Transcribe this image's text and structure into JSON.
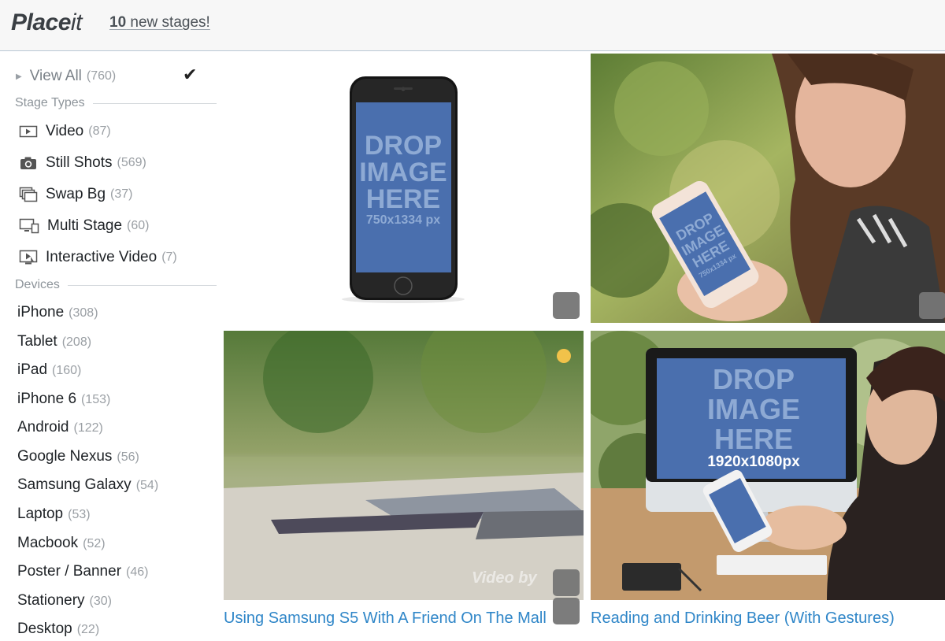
{
  "header": {
    "logo_bold": "Place",
    "logo_light": "it",
    "new_stages_count": "10",
    "new_stages_text": "new stages!"
  },
  "sidebar": {
    "view_all": {
      "label": "View All",
      "count": "(760)",
      "selected": true
    },
    "stage_types_heading": "Stage Types",
    "stage_types": [
      {
        "label": "Video",
        "count": "(87)",
        "icon": "video-icon"
      },
      {
        "label": "Still Shots",
        "count": "(569)",
        "icon": "camera-icon"
      },
      {
        "label": "Swap Bg",
        "count": "(37)",
        "icon": "swap-bg-icon"
      },
      {
        "label": "Multi Stage",
        "count": "(60)",
        "icon": "multi-stage-icon"
      },
      {
        "label": "Interactive Video",
        "count": "(7)",
        "icon": "interactive-video-icon"
      }
    ],
    "devices_heading": "Devices",
    "devices": [
      {
        "label": "iPhone",
        "count": "(308)"
      },
      {
        "label": "Tablet",
        "count": "(208)"
      },
      {
        "label": "iPad",
        "count": "(160)"
      },
      {
        "label": "iPhone 6",
        "count": "(153)"
      },
      {
        "label": "Android",
        "count": "(122)"
      },
      {
        "label": "Google Nexus",
        "count": "(56)"
      },
      {
        "label": "Samsung Galaxy",
        "count": "(54)"
      },
      {
        "label": "Laptop",
        "count": "(53)"
      },
      {
        "label": "Macbook",
        "count": "(52)"
      },
      {
        "label": "Poster / Banner",
        "count": "(46)"
      },
      {
        "label": "Stationery",
        "count": "(30)"
      },
      {
        "label": "Desktop",
        "count": "(22)"
      }
    ]
  },
  "stages": [
    {
      "drop_line1": "DROP",
      "drop_line2": "IMAGE",
      "drop_line3": "HERE",
      "size": "750x1334 px"
    },
    {
      "drop_line1": "DROP",
      "drop_line2": "IMAGE",
      "drop_line3": "HERE",
      "size": "750x1334 px"
    },
    {
      "caption": "Using Samsung S5 With A Friend On The Mall",
      "watermark": "Video by"
    },
    {
      "drop_line1": "DROP",
      "drop_line2": "IMAGE",
      "drop_line3": "HERE",
      "size": "1920x1080px",
      "caption": "Reading and Drinking Beer (With Gestures)"
    }
  ],
  "colors": {
    "link_blue": "#2f86c8",
    "drop_blue": "#4a6fae",
    "option_button": "#757575"
  }
}
